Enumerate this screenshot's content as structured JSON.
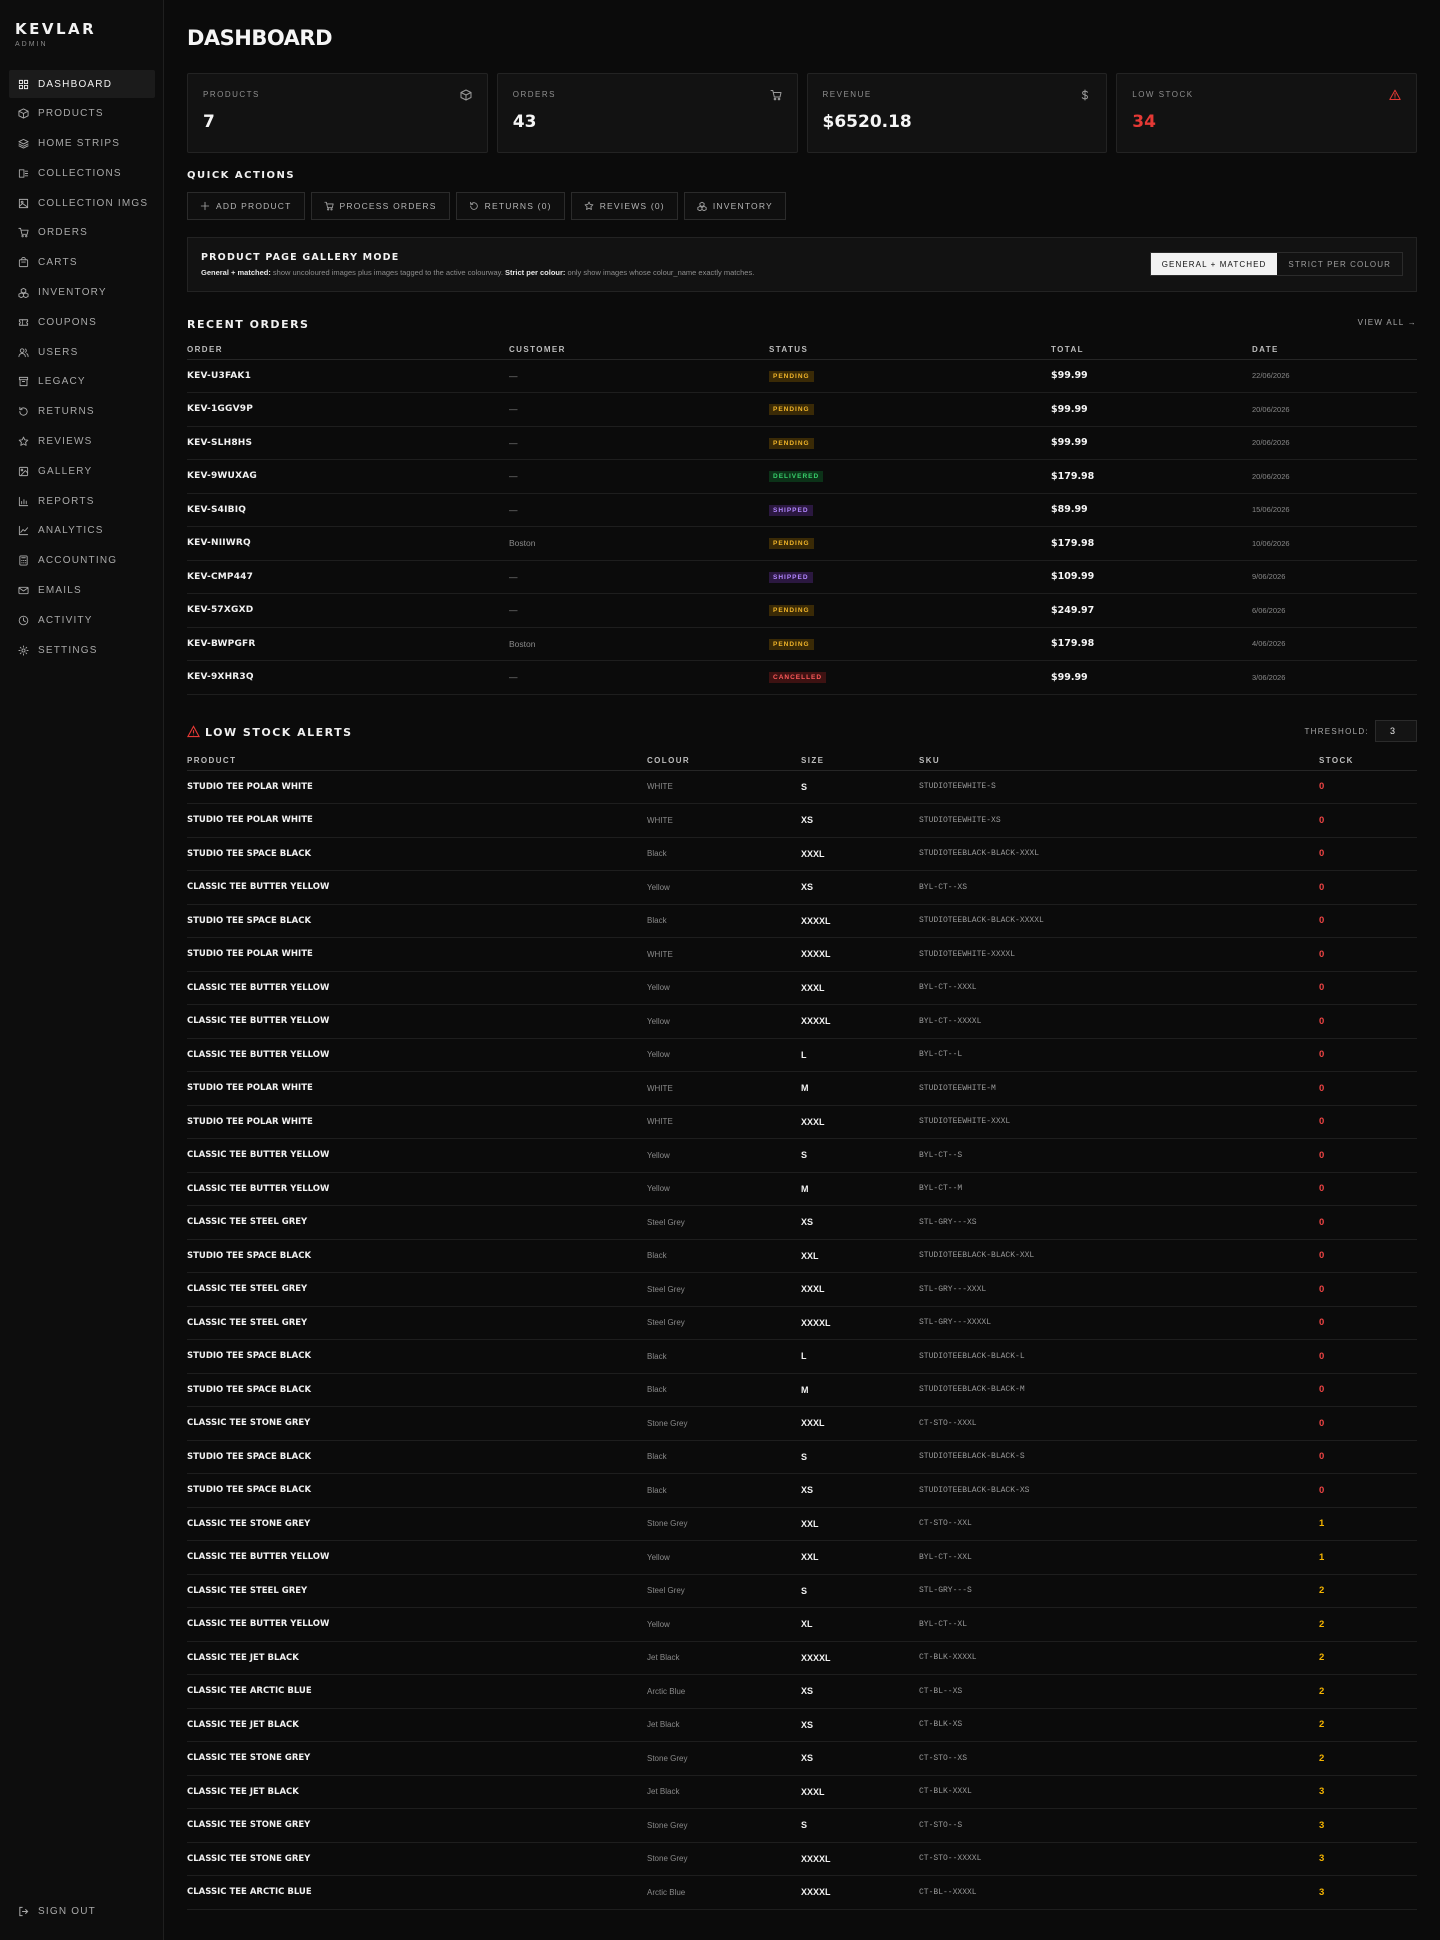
{
  "brand": {
    "name": "KEVLAR",
    "sub": "ADMIN"
  },
  "nav": [
    {
      "label": "DASHBOARD",
      "icon": "grid-icon"
    },
    {
      "label": "PRODUCTS",
      "icon": "box-icon"
    },
    {
      "label": "HOME STRIPS",
      "icon": "layers-icon"
    },
    {
      "label": "COLLECTIONS",
      "icon": "collection-icon"
    },
    {
      "label": "COLLECTION IMGS",
      "icon": "image-icon"
    },
    {
      "label": "ORDERS",
      "icon": "cart-icon"
    },
    {
      "label": "CARTS",
      "icon": "bag-icon"
    },
    {
      "label": "INVENTORY",
      "icon": "boxes-icon"
    },
    {
      "label": "COUPONS",
      "icon": "ticket-icon"
    },
    {
      "label": "USERS",
      "icon": "users-icon"
    },
    {
      "label": "LEGACY",
      "icon": "archive-icon"
    },
    {
      "label": "RETURNS",
      "icon": "returns-icon"
    },
    {
      "label": "REVIEWS",
      "icon": "star-icon"
    },
    {
      "label": "GALLERY",
      "icon": "gallery-icon"
    },
    {
      "label": "REPORTS",
      "icon": "bar-chart-icon"
    },
    {
      "label": "ANALYTICS",
      "icon": "line-chart-icon"
    },
    {
      "label": "ACCOUNTING",
      "icon": "calculator-icon"
    },
    {
      "label": "EMAILS",
      "icon": "mail-icon"
    },
    {
      "label": "ACTIVITY",
      "icon": "clock-icon"
    },
    {
      "label": "SETTINGS",
      "icon": "gear-icon"
    }
  ],
  "signout": "SIGN OUT",
  "page_title": "DASHBOARD",
  "stats": [
    {
      "label": "PRODUCTS",
      "value": "7",
      "icon": "box-icon"
    },
    {
      "label": "ORDERS",
      "value": "43",
      "icon": "cart-icon"
    },
    {
      "label": "REVENUE",
      "value": "$6520.18",
      "icon": "dollar-icon"
    },
    {
      "label": "LOW STOCK",
      "value": "34",
      "icon": "warning-icon"
    }
  ],
  "quick_actions": {
    "title": "QUICK ACTIONS",
    "buttons": [
      "ADD PRODUCT",
      "PROCESS ORDERS",
      "RETURNS (0)",
      "REVIEWS (0)",
      "INVENTORY"
    ]
  },
  "gallery_mode": {
    "title": "PRODUCT PAGE GALLERY MODE",
    "desc_b1": "General + matched:",
    "desc_t1": " show uncoloured images plus images tagged to the active colourway. ",
    "desc_b2": "Strict per colour:",
    "desc_t2": " only show images whose colour_name exactly matches.",
    "option_general": "GENERAL + MATCHED",
    "option_strict": "STRICT PER COLOUR"
  },
  "recent_orders": {
    "title": "RECENT ORDERS",
    "view_all": "VIEW ALL →",
    "headers": [
      "ORDER",
      "CUSTOMER",
      "STATUS",
      "TOTAL",
      "DATE"
    ],
    "rows": [
      [
        "KEV-U3FAK1",
        "—",
        "PENDING",
        "$99.99",
        "22/06/2026"
      ],
      [
        "KEV-1GGV9P",
        "—",
        "PENDING",
        "$99.99",
        "20/06/2026"
      ],
      [
        "KEV-SLH8HS",
        "—",
        "PENDING",
        "$99.99",
        "20/06/2026"
      ],
      [
        "KEV-9WUXAG",
        "—",
        "DELIVERED",
        "$179.98",
        "20/06/2026"
      ],
      [
        "KEV-S4IBIQ",
        "—",
        "SHIPPED",
        "$89.99",
        "15/06/2026"
      ],
      [
        "KEV-NIIWRQ",
        "Boston",
        "PENDING",
        "$179.98",
        "10/06/2026"
      ],
      [
        "KEV-CMP447",
        "—",
        "SHIPPED",
        "$109.99",
        "9/06/2026"
      ],
      [
        "KEV-57XGXD",
        "—",
        "PENDING",
        "$249.97",
        "6/06/2026"
      ],
      [
        "KEV-BWPGFR",
        "Boston",
        "PENDING",
        "$179.98",
        "4/06/2026"
      ],
      [
        "KEV-9XHR3Q",
        "—",
        "CANCELLED",
        "$99.99",
        "3/06/2026"
      ]
    ]
  },
  "low_stock": {
    "title": "LOW STOCK ALERTS",
    "threshold_label": "THRESHOLD:",
    "threshold_value": "3",
    "headers": [
      "PRODUCT",
      "COLOUR",
      "SIZE",
      "SKU",
      "STOCK"
    ],
    "rows": [
      [
        "STUDIO TEE POLAR WHITE",
        "WHITE",
        "S",
        "STUDIOTEEWHITE-S",
        "0"
      ],
      [
        "STUDIO TEE POLAR WHITE",
        "WHITE",
        "XS",
        "STUDIOTEEWHITE-XS",
        "0"
      ],
      [
        "STUDIO TEE SPACE BLACK",
        "Black",
        "XXXL",
        "STUDIOTEEBLACK-BLACK-XXXL",
        "0"
      ],
      [
        "CLASSIC TEE BUTTER YELLOW",
        "Yellow",
        "XS",
        "BYL-CT--XS",
        "0"
      ],
      [
        "STUDIO TEE SPACE BLACK",
        "Black",
        "XXXXL",
        "STUDIOTEEBLACK-BLACK-XXXXL",
        "0"
      ],
      [
        "STUDIO TEE POLAR WHITE",
        "WHITE",
        "XXXXL",
        "STUDIOTEEWHITE-XXXXL",
        "0"
      ],
      [
        "CLASSIC TEE BUTTER YELLOW",
        "Yellow",
        "XXXL",
        "BYL-CT--XXXL",
        "0"
      ],
      [
        "CLASSIC TEE BUTTER YELLOW",
        "Yellow",
        "XXXXL",
        "BYL-CT--XXXXL",
        "0"
      ],
      [
        "CLASSIC TEE BUTTER YELLOW",
        "Yellow",
        "L",
        "BYL-CT--L",
        "0"
      ],
      [
        "STUDIO TEE POLAR WHITE",
        "WHITE",
        "M",
        "STUDIOTEEWHITE-M",
        "0"
      ],
      [
        "STUDIO TEE POLAR WHITE",
        "WHITE",
        "XXXL",
        "STUDIOTEEWHITE-XXXL",
        "0"
      ],
      [
        "CLASSIC TEE BUTTER YELLOW",
        "Yellow",
        "S",
        "BYL-CT--S",
        "0"
      ],
      [
        "CLASSIC TEE BUTTER YELLOW",
        "Yellow",
        "M",
        "BYL-CT--M",
        "0"
      ],
      [
        "CLASSIC TEE STEEL GREY",
        "Steel Grey",
        "XS",
        "STL-GRY---XS",
        "0"
      ],
      [
        "STUDIO TEE SPACE BLACK",
        "Black",
        "XXL",
        "STUDIOTEEBLACK-BLACK-XXL",
        "0"
      ],
      [
        "CLASSIC TEE STEEL GREY",
        "Steel Grey",
        "XXXL",
        "STL-GRY---XXXL",
        "0"
      ],
      [
        "CLASSIC TEE STEEL GREY",
        "Steel Grey",
        "XXXXL",
        "STL-GRY---XXXXL",
        "0"
      ],
      [
        "STUDIO TEE SPACE BLACK",
        "Black",
        "L",
        "STUDIOTEEBLACK-BLACK-L",
        "0"
      ],
      [
        "STUDIO TEE SPACE BLACK",
        "Black",
        "M",
        "STUDIOTEEBLACK-BLACK-M",
        "0"
      ],
      [
        "CLASSIC TEE STONE GREY",
        "Stone Grey",
        "XXXL",
        "CT-STO--XXXL",
        "0"
      ],
      [
        "STUDIO TEE SPACE BLACK",
        "Black",
        "S",
        "STUDIOTEEBLACK-BLACK-S",
        "0"
      ],
      [
        "STUDIO TEE SPACE BLACK",
        "Black",
        "XS",
        "STUDIOTEEBLACK-BLACK-XS",
        "0"
      ],
      [
        "CLASSIC TEE STONE GREY",
        "Stone Grey",
        "XXL",
        "CT-STO--XXL",
        "1"
      ],
      [
        "CLASSIC TEE BUTTER YELLOW",
        "Yellow",
        "XXL",
        "BYL-CT--XXL",
        "1"
      ],
      [
        "CLASSIC TEE STEEL GREY",
        "Steel Grey",
        "S",
        "STL-GRY---S",
        "2"
      ],
      [
        "CLASSIC TEE BUTTER YELLOW",
        "Yellow",
        "XL",
        "BYL-CT--XL",
        "2"
      ],
      [
        "CLASSIC TEE JET BLACK",
        "Jet Black",
        "XXXXL",
        "CT-BLK-XXXXL",
        "2"
      ],
      [
        "CLASSIC TEE ARCTIC BLUE",
        "Arctic Blue",
        "XS",
        "CT-BL--XS",
        "2"
      ],
      [
        "CLASSIC TEE JET BLACK",
        "Jet Black",
        "XS",
        "CT-BLK-XS",
        "2"
      ],
      [
        "CLASSIC TEE STONE GREY",
        "Stone Grey",
        "XS",
        "CT-STO--XS",
        "2"
      ],
      [
        "CLASSIC TEE JET BLACK",
        "Jet Black",
        "XXXL",
        "CT-BLK-XXXL",
        "3"
      ],
      [
        "CLASSIC TEE STONE GREY",
        "Stone Grey",
        "S",
        "CT-STO--S",
        "3"
      ],
      [
        "CLASSIC TEE STONE GREY",
        "Stone Grey",
        "XXXXL",
        "CT-STO--XXXXL",
        "3"
      ],
      [
        "CLASSIC TEE ARCTIC BLUE",
        "Arctic Blue",
        "XXXXL",
        "CT-BL--XXXXL",
        "3"
      ]
    ]
  },
  "colors": {
    "background": "#0b0b0b",
    "panel": "#121212",
    "accent_red": "#e53935",
    "stock_zero": "#ef4444",
    "stock_low": "#f5b400",
    "pending": "#f0b429",
    "delivered": "#38d06b",
    "shipped": "#b387ff",
    "cancelled": "#ff5a5a"
  }
}
